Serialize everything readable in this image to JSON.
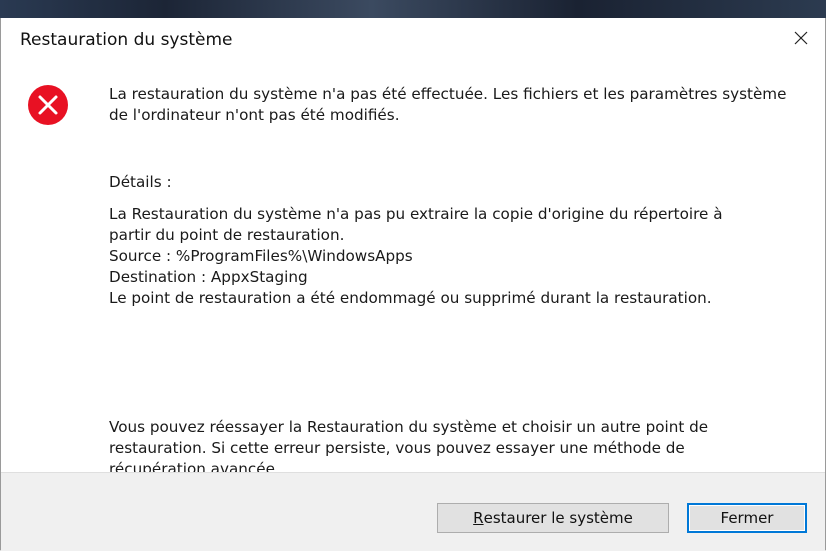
{
  "window": {
    "title": "Restauration du système",
    "close_icon": "close-icon"
  },
  "error_icon": {
    "name": "error-icon",
    "color": "#e81123"
  },
  "message": {
    "main": "La restauration du système n'a pas été effectuée. Les fichiers et les paramètres système de l'ordinateur n'ont pas été modifiés.",
    "details_heading": "Détails :",
    "details_lines": [
      "La Restauration du système n'a pas pu extraire la copie d'origine du répertoire à",
      "partir du point de restauration.",
      " Source : %ProgramFiles%\\WindowsApps",
      " Destination : AppxStaging",
      "Le point de restauration a été endommagé ou supprimé durant la restauration."
    ],
    "advice": "Vous pouvez réessayer la Restauration du système et choisir un autre point de restauration. Si cette erreur persiste, vous pouvez essayer une méthode de récupération avancée."
  },
  "buttons": {
    "restore_mnemonic": "R",
    "restore_rest": "estaurer le système",
    "close_label": "Fermer"
  },
  "colors": {
    "accent": "#0078d7",
    "footer_bg": "#f0f0f0",
    "button_bg": "#e1e1e1"
  }
}
